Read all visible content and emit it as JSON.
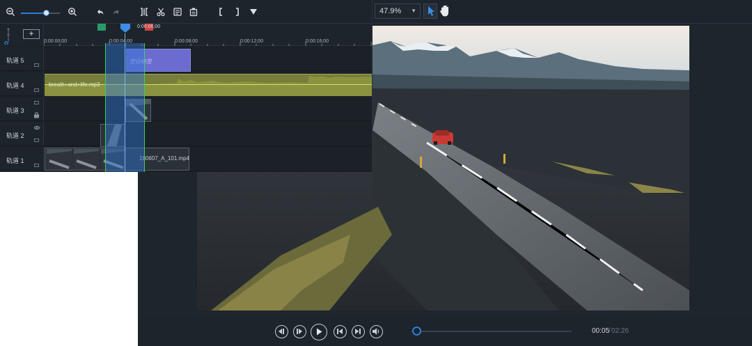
{
  "timeline": {
    "ruler": {
      "ticks": [
        "0:00:00;00",
        "0:00:04;00",
        "0:00:08;00",
        "0:00:12;00",
        "0:00:16;00"
      ],
      "playhead_time": "0:00:06;00"
    },
    "tracks": [
      {
        "label": "轨道 5"
      },
      {
        "label": "轨道 4"
      },
      {
        "label": "轨道 3"
      },
      {
        "label": "轨道 2"
      },
      {
        "label": "轨道 1"
      }
    ],
    "clips": {
      "subtitle_text": "空白标签",
      "audio_name": "breath+and+life.mp3",
      "video_name": "180607_A_101.mp4"
    },
    "toolbar": {
      "icons": [
        "zoom-out-icon",
        "zoom-in-icon",
        "undo-icon",
        "redo-icon",
        "split-icon",
        "cut-icon",
        "copy-icon",
        "paste-icon",
        "mark-in-icon",
        "mark-out-icon",
        "marker-icon"
      ],
      "add_track_label": "+"
    },
    "colors": {
      "selection": "#2f78d6",
      "selection_border": "#3ad06a",
      "subtitle_clip": "#6c6bd0",
      "audio_clip": "#767d3a",
      "in_marker": "#2a9b68",
      "out_marker": "#d0453f"
    }
  },
  "preview": {
    "zoom_value": "47.9%",
    "time_current": "00:05",
    "time_separator": "/",
    "time_total": "02:26",
    "progress_fraction": 0.034,
    "controls": [
      "previous-frame-icon",
      "next-frame-icon",
      "play-icon",
      "skip-to-start-icon",
      "skip-to-end-icon",
      "volume-icon"
    ],
    "accent_color": "#2d7fd8"
  }
}
